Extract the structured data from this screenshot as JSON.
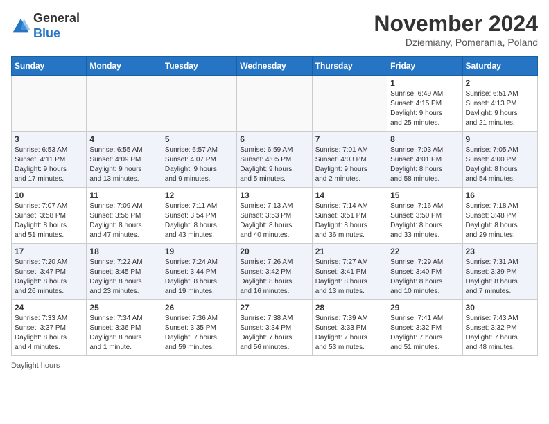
{
  "header": {
    "logo_line1": "General",
    "logo_line2": "Blue",
    "month_title": "November 2024",
    "location": "Dziemiany, Pomerania, Poland"
  },
  "days_of_week": [
    "Sunday",
    "Monday",
    "Tuesday",
    "Wednesday",
    "Thursday",
    "Friday",
    "Saturday"
  ],
  "weeks": [
    [
      {
        "day": "",
        "info": ""
      },
      {
        "day": "",
        "info": ""
      },
      {
        "day": "",
        "info": ""
      },
      {
        "day": "",
        "info": ""
      },
      {
        "day": "",
        "info": ""
      },
      {
        "day": "1",
        "info": "Sunrise: 6:49 AM\nSunset: 4:15 PM\nDaylight: 9 hours\nand 25 minutes."
      },
      {
        "day": "2",
        "info": "Sunrise: 6:51 AM\nSunset: 4:13 PM\nDaylight: 9 hours\nand 21 minutes."
      }
    ],
    [
      {
        "day": "3",
        "info": "Sunrise: 6:53 AM\nSunset: 4:11 PM\nDaylight: 9 hours\nand 17 minutes."
      },
      {
        "day": "4",
        "info": "Sunrise: 6:55 AM\nSunset: 4:09 PM\nDaylight: 9 hours\nand 13 minutes."
      },
      {
        "day": "5",
        "info": "Sunrise: 6:57 AM\nSunset: 4:07 PM\nDaylight: 9 hours\nand 9 minutes."
      },
      {
        "day": "6",
        "info": "Sunrise: 6:59 AM\nSunset: 4:05 PM\nDaylight: 9 hours\nand 5 minutes."
      },
      {
        "day": "7",
        "info": "Sunrise: 7:01 AM\nSunset: 4:03 PM\nDaylight: 9 hours\nand 2 minutes."
      },
      {
        "day": "8",
        "info": "Sunrise: 7:03 AM\nSunset: 4:01 PM\nDaylight: 8 hours\nand 58 minutes."
      },
      {
        "day": "9",
        "info": "Sunrise: 7:05 AM\nSunset: 4:00 PM\nDaylight: 8 hours\nand 54 minutes."
      }
    ],
    [
      {
        "day": "10",
        "info": "Sunrise: 7:07 AM\nSunset: 3:58 PM\nDaylight: 8 hours\nand 51 minutes."
      },
      {
        "day": "11",
        "info": "Sunrise: 7:09 AM\nSunset: 3:56 PM\nDaylight: 8 hours\nand 47 minutes."
      },
      {
        "day": "12",
        "info": "Sunrise: 7:11 AM\nSunset: 3:54 PM\nDaylight: 8 hours\nand 43 minutes."
      },
      {
        "day": "13",
        "info": "Sunrise: 7:13 AM\nSunset: 3:53 PM\nDaylight: 8 hours\nand 40 minutes."
      },
      {
        "day": "14",
        "info": "Sunrise: 7:14 AM\nSunset: 3:51 PM\nDaylight: 8 hours\nand 36 minutes."
      },
      {
        "day": "15",
        "info": "Sunrise: 7:16 AM\nSunset: 3:50 PM\nDaylight: 8 hours\nand 33 minutes."
      },
      {
        "day": "16",
        "info": "Sunrise: 7:18 AM\nSunset: 3:48 PM\nDaylight: 8 hours\nand 29 minutes."
      }
    ],
    [
      {
        "day": "17",
        "info": "Sunrise: 7:20 AM\nSunset: 3:47 PM\nDaylight: 8 hours\nand 26 minutes."
      },
      {
        "day": "18",
        "info": "Sunrise: 7:22 AM\nSunset: 3:45 PM\nDaylight: 8 hours\nand 23 minutes."
      },
      {
        "day": "19",
        "info": "Sunrise: 7:24 AM\nSunset: 3:44 PM\nDaylight: 8 hours\nand 19 minutes."
      },
      {
        "day": "20",
        "info": "Sunrise: 7:26 AM\nSunset: 3:42 PM\nDaylight: 8 hours\nand 16 minutes."
      },
      {
        "day": "21",
        "info": "Sunrise: 7:27 AM\nSunset: 3:41 PM\nDaylight: 8 hours\nand 13 minutes."
      },
      {
        "day": "22",
        "info": "Sunrise: 7:29 AM\nSunset: 3:40 PM\nDaylight: 8 hours\nand 10 minutes."
      },
      {
        "day": "23",
        "info": "Sunrise: 7:31 AM\nSunset: 3:39 PM\nDaylight: 8 hours\nand 7 minutes."
      }
    ],
    [
      {
        "day": "24",
        "info": "Sunrise: 7:33 AM\nSunset: 3:37 PM\nDaylight: 8 hours\nand 4 minutes."
      },
      {
        "day": "25",
        "info": "Sunrise: 7:34 AM\nSunset: 3:36 PM\nDaylight: 8 hours\nand 1 minute."
      },
      {
        "day": "26",
        "info": "Sunrise: 7:36 AM\nSunset: 3:35 PM\nDaylight: 7 hours\nand 59 minutes."
      },
      {
        "day": "27",
        "info": "Sunrise: 7:38 AM\nSunset: 3:34 PM\nDaylight: 7 hours\nand 56 minutes."
      },
      {
        "day": "28",
        "info": "Sunrise: 7:39 AM\nSunset: 3:33 PM\nDaylight: 7 hours\nand 53 minutes."
      },
      {
        "day": "29",
        "info": "Sunrise: 7:41 AM\nSunset: 3:32 PM\nDaylight: 7 hours\nand 51 minutes."
      },
      {
        "day": "30",
        "info": "Sunrise: 7:43 AM\nSunset: 3:32 PM\nDaylight: 7 hours\nand 48 minutes."
      }
    ]
  ],
  "legend": {
    "daylight_hours": "Daylight hours"
  }
}
